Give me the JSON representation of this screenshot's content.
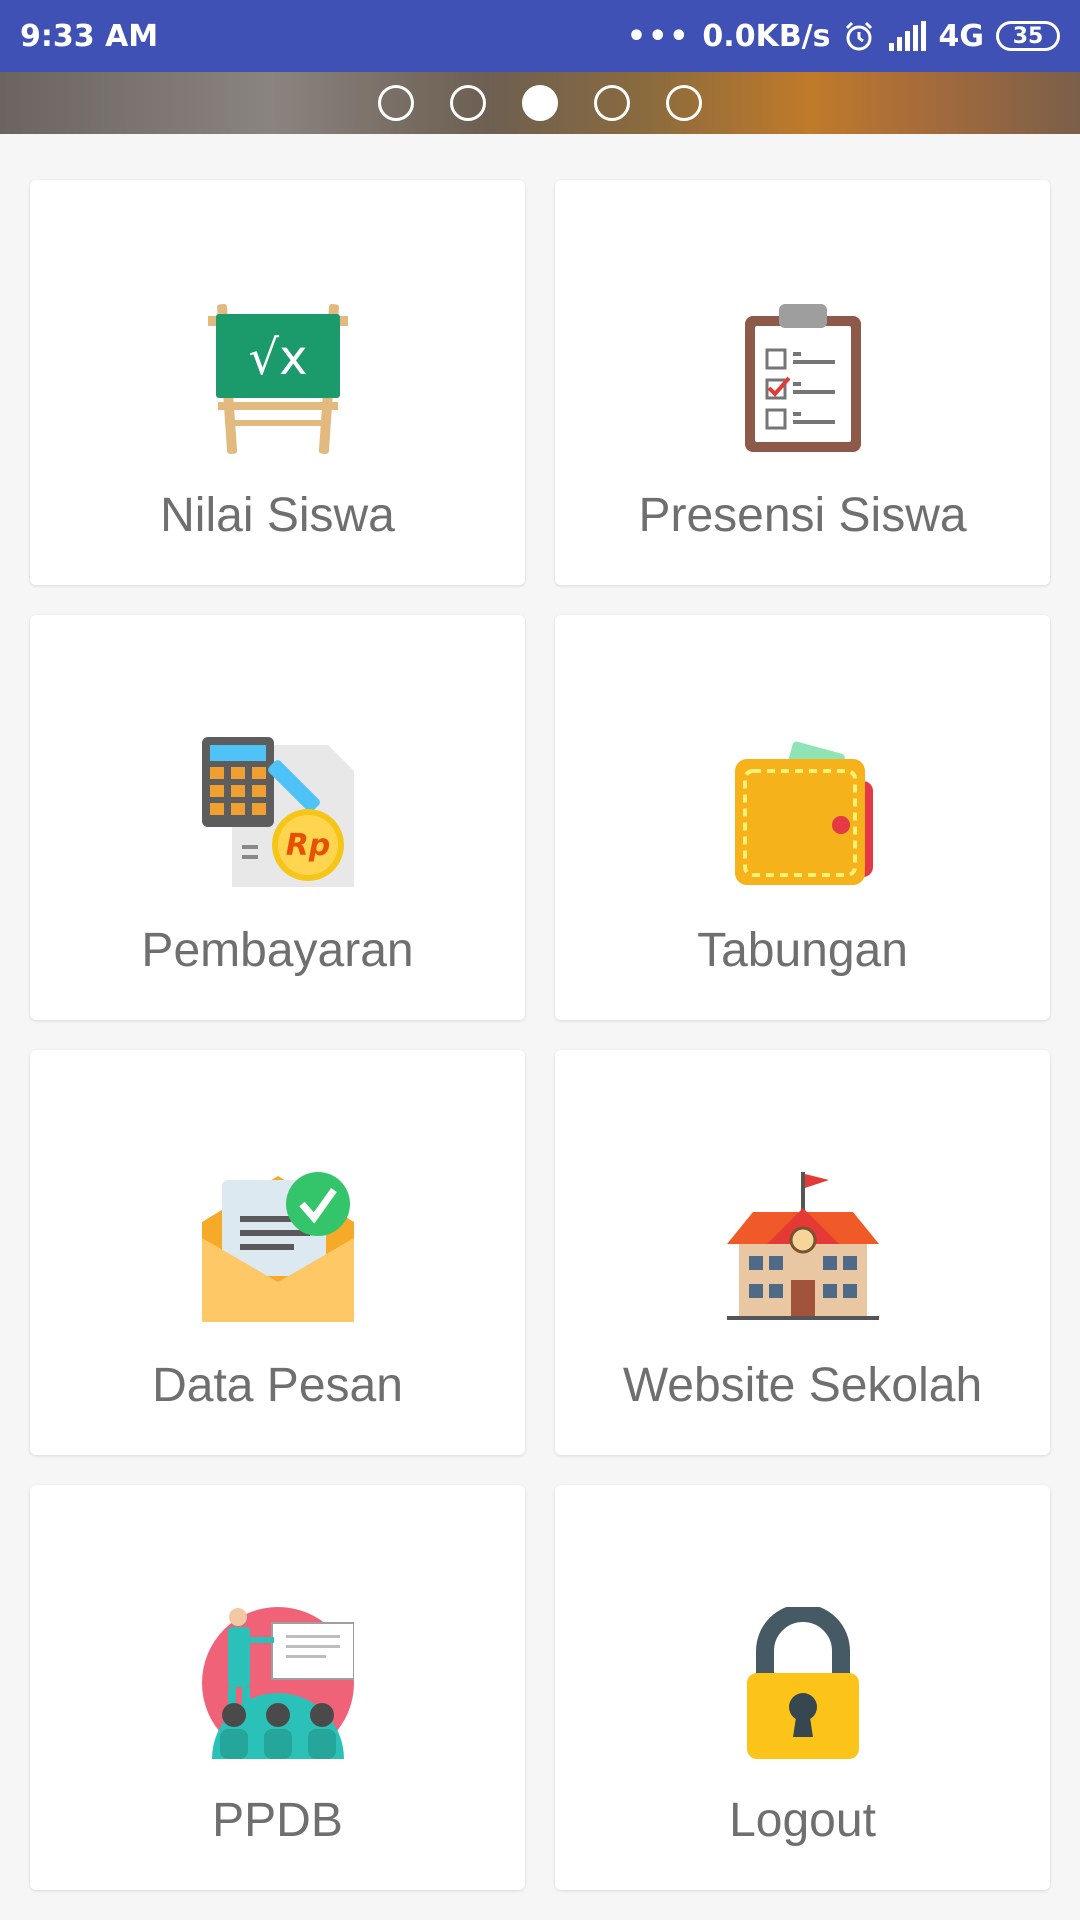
{
  "status_bar": {
    "time": "9:33 AM",
    "network_speed": "0.0KB/s",
    "network_type": "4G",
    "battery": "35"
  },
  "banner": {
    "page_count": 5,
    "active_page": 3
  },
  "menu": [
    {
      "label": "Nilai Siswa",
      "icon": "chalkboard-sqrt-icon"
    },
    {
      "label": "Presensi Siswa",
      "icon": "clipboard-checklist-icon"
    },
    {
      "label": "Pembayaran",
      "icon": "calculator-payment-icon"
    },
    {
      "label": "Tabungan",
      "icon": "wallet-icon"
    },
    {
      "label": "Data Pesan",
      "icon": "envelope-message-icon"
    },
    {
      "label": "Website Sekolah",
      "icon": "school-building-icon"
    },
    {
      "label": "PPDB",
      "icon": "presentation-teacher-icon"
    },
    {
      "label": "Logout",
      "icon": "padlock-icon"
    }
  ],
  "colors": {
    "status_bar": "#3f51b5",
    "label_text": "#6f6f6f"
  }
}
